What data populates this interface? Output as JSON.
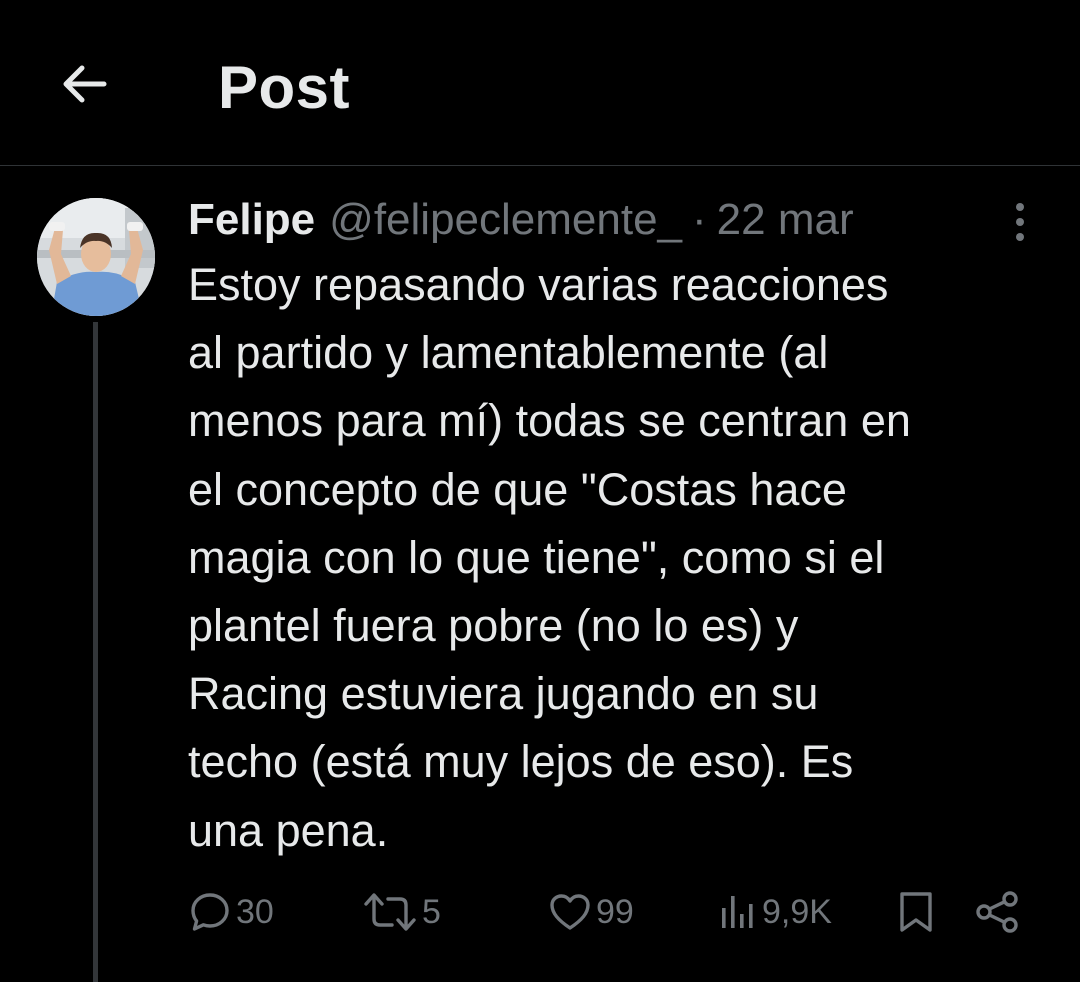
{
  "header": {
    "back_icon": "arrow-left-icon",
    "title": "Post"
  },
  "post": {
    "avatar_icon": "user-avatar",
    "display_name": "Felipe",
    "handle": "@felipeclemente_",
    "separator": "·",
    "date": "22 mar",
    "more_icon": "more-vertical-icon",
    "text_lines": [
      "Estoy repasando varias reacciones",
      "al partido y lamentablemente (al",
      "menos para mí) todas se centran en",
      "el concepto de que \"Costas hace",
      "magia con lo que tiene\", como si el",
      "plantel fuera pobre (no lo es) y",
      "Racing estuviera jugando en su",
      "techo (está muy lejos de eso). Es",
      "una pena."
    ]
  },
  "actions": {
    "replies": {
      "icon": "reply-icon",
      "count": "30"
    },
    "reposts": {
      "icon": "repost-icon",
      "count": "5"
    },
    "likes": {
      "icon": "heart-icon",
      "count": "99"
    },
    "views": {
      "icon": "views-icon",
      "count": "9,9K"
    },
    "bookmark": {
      "icon": "bookmark-icon"
    },
    "share": {
      "icon": "share-icon"
    }
  },
  "colors": {
    "background": "#000000",
    "text": "#e7e9ea",
    "muted": "#71767b",
    "divider": "#2f3336"
  }
}
